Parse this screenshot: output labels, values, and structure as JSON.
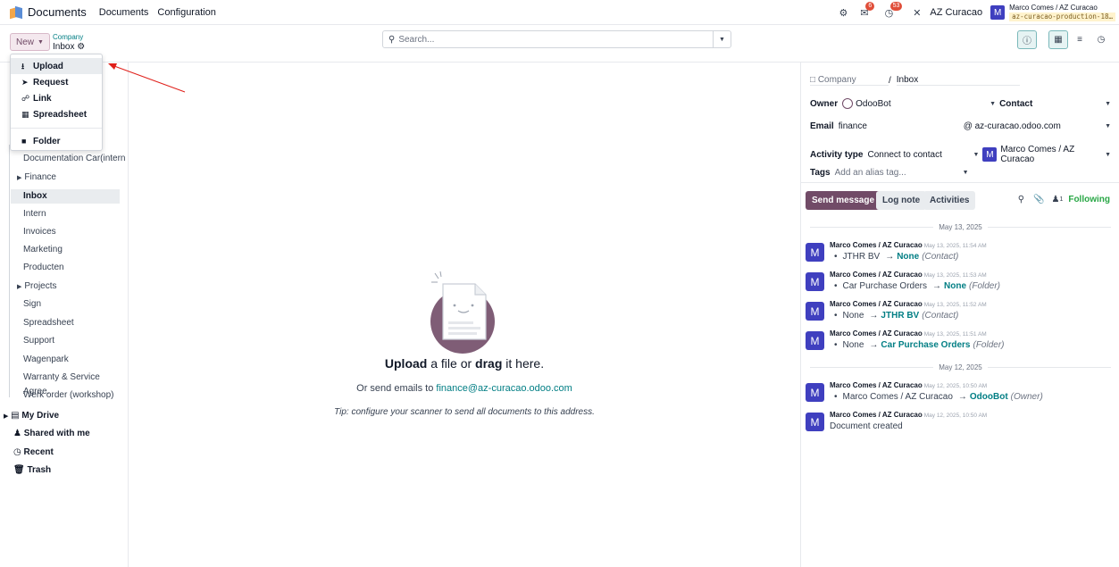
{
  "navbar": {
    "app_name": "Documents",
    "menu": [
      "Documents",
      "Configuration"
    ],
    "notif_chat_count": "6",
    "notif_activity_count": "53",
    "company": "AZ Curacao",
    "user_initial": "M",
    "user_name": "Marco Comes / AZ Curacao",
    "database": "az-curacao-production-18…"
  },
  "control": {
    "new_label": "New",
    "breadcrumb_parent": "Company",
    "breadcrumb_current": "Inbox",
    "search_placeholder": "Search..."
  },
  "dropdown": {
    "items": [
      {
        "label": "Upload",
        "icon": "upload-icon"
      },
      {
        "label": "Request",
        "icon": "paper-plane-icon"
      },
      {
        "label": "Link",
        "icon": "link-icon"
      },
      {
        "label": "Spreadsheet",
        "icon": "spreadsheet-icon"
      },
      {
        "label": "Folder",
        "icon": "folder-icon"
      }
    ]
  },
  "sidebar": {
    "folders": [
      {
        "label": "Documentation Car(intern"
      },
      {
        "label": "Finance",
        "expandable": true
      },
      {
        "label": "Inbox",
        "active": true
      },
      {
        "label": "Intern"
      },
      {
        "label": "Invoices"
      },
      {
        "label": "Marketing"
      },
      {
        "label": "Producten"
      },
      {
        "label": "Projects",
        "expandable": true
      },
      {
        "label": "Sign"
      },
      {
        "label": "Spreadsheet"
      },
      {
        "label": "Support"
      },
      {
        "label": "Wagenpark"
      },
      {
        "label": "Warranty & Service Agree."
      },
      {
        "label": "Werk order (workshop)"
      }
    ],
    "roots": [
      {
        "label": "My Drive",
        "icon": "drive-icon"
      },
      {
        "label": "Shared with me",
        "icon": "users-icon"
      },
      {
        "label": "Recent",
        "icon": "clock-icon"
      },
      {
        "label": "Trash",
        "icon": "trash-icon"
      }
    ]
  },
  "main": {
    "upload_bold1": "Upload",
    "upload_mid": "a file or",
    "upload_bold2": "drag",
    "upload_end": "it here.",
    "email_prefix": "Or send emails to",
    "email": "finance@az-curacao.odoo.com",
    "tip": "Tip: configure your scanner to send all documents to this address."
  },
  "panel": {
    "path_company": "Company",
    "path_sep": "/",
    "path_folder": "Inbox",
    "owner_label": "Owner",
    "owner_value": "OdooBot",
    "contact_label": "Contact",
    "email_label": "Email",
    "email_value": "finance",
    "email_domain": "@ az-curacao.odoo.com",
    "activity_label": "Activity type",
    "activity_value": "Connect to contact",
    "activity_user": "Marco Comes / AZ Curacao",
    "tags_label": "Tags",
    "tags_placeholder": "Add an alias tag...",
    "send_message": "Send message",
    "log_note": "Log note",
    "activities": "Activities",
    "followers_count": "1",
    "following": "Following"
  },
  "chatter": {
    "date1": "May 13, 2025",
    "date2": "May 12, 2025",
    "messages": [
      {
        "author": "Marco Comes / AZ Curacao",
        "date": "May 13, 2025, 11:54 AM",
        "old": "JTHR BV",
        "new": "None",
        "field": "(Contact)"
      },
      {
        "author": "Marco Comes / AZ Curacao",
        "date": "May 13, 2025, 11:53 AM",
        "old": "Car Purchase Orders",
        "new": "None",
        "field": "(Folder)"
      },
      {
        "author": "Marco Comes / AZ Curacao",
        "date": "May 13, 2025, 11:52 AM",
        "old": "None",
        "new": "JTHR BV",
        "field": "(Contact)"
      },
      {
        "author": "Marco Comes / AZ Curacao",
        "date": "May 13, 2025, 11:51 AM",
        "old": "None",
        "new": "Car Purchase Orders",
        "field": "(Folder)"
      },
      {
        "author": "Marco Comes / AZ Curacao",
        "date": "May 12, 2025, 10:50 AM",
        "old": "Marco Comes / AZ Curacao",
        "new": "OdooBot",
        "field": "(Owner)"
      },
      {
        "author": "Marco Comes / AZ Curacao",
        "date": "May 12, 2025, 10:50 AM",
        "text": "Document created"
      }
    ]
  },
  "colors": {
    "primary": "#714b67",
    "link": "#017e84",
    "avatar": "#3f3fbf",
    "following": "#28a745",
    "annotation_arrow": "#e0201a"
  }
}
